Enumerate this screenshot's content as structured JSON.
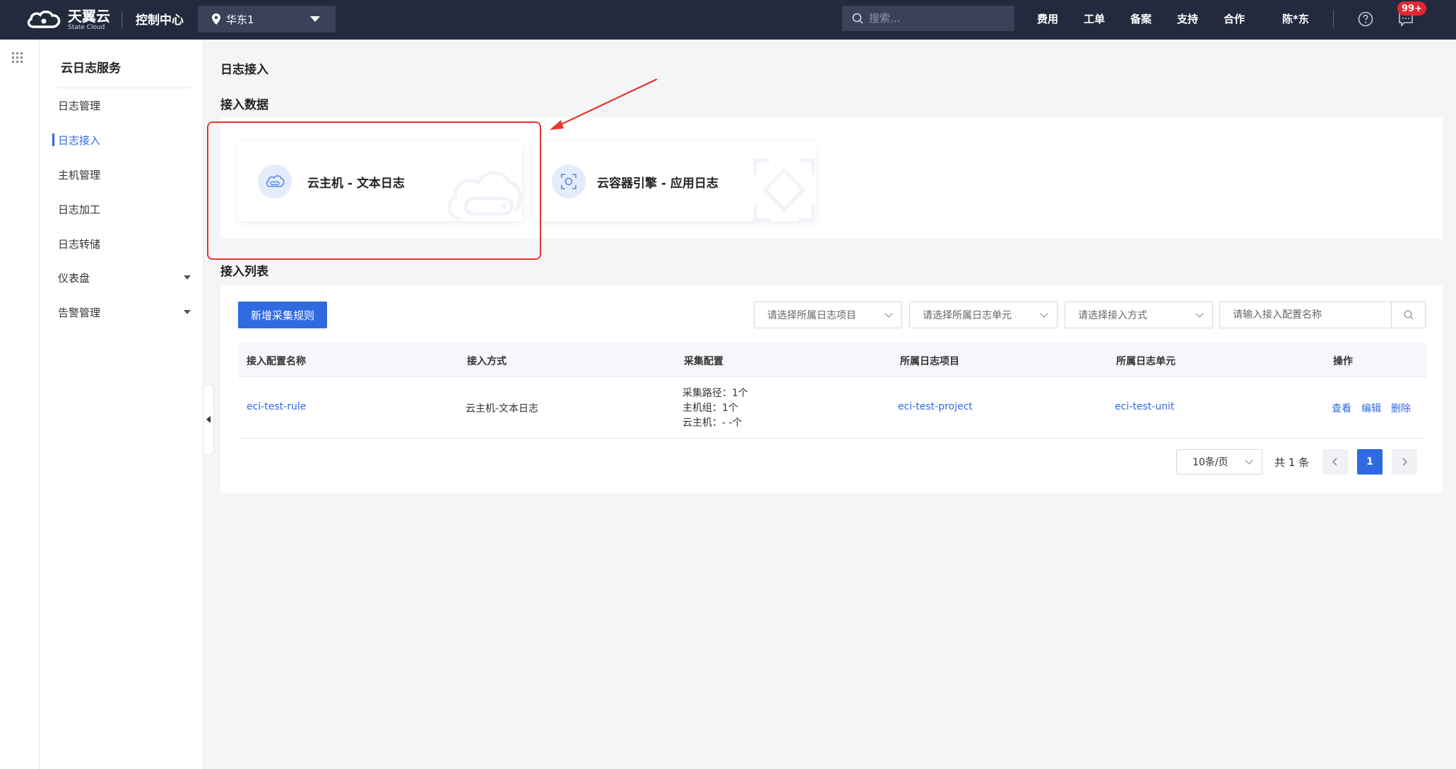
{
  "topbar": {
    "logo_main": "天翼云",
    "logo_sub": "State Cloud",
    "console_title": "控制中心",
    "region": "华东1",
    "search_placeholder": "搜索...",
    "nav": [
      "费用",
      "工单",
      "备案",
      "支持",
      "合作"
    ],
    "user": "陈*东",
    "badge": "99+"
  },
  "sidebar": {
    "title": "云日志服务",
    "items": [
      {
        "label": "日志管理"
      },
      {
        "label": "日志接入",
        "active": true
      },
      {
        "label": "主机管理"
      },
      {
        "label": "日志加工"
      },
      {
        "label": "日志转储"
      },
      {
        "label": "仪表盘",
        "expandable": true
      },
      {
        "label": "告警管理",
        "expandable": true
      }
    ]
  },
  "main": {
    "page_title": "日志接入",
    "ingest_section_title": "接入数据",
    "cards": [
      {
        "label": "云主机 - 文本日志",
        "icon": "cloud-host-icon"
      },
      {
        "label": "云容器引擎 - 应用日志",
        "icon": "container-icon"
      }
    ],
    "list_section_title": "接入列表",
    "add_button": "新增采集规则",
    "filters": {
      "project_placeholder": "请选择所属日志项目",
      "unit_placeholder": "请选择所属日志单元",
      "method_placeholder": "请选择接入方式",
      "name_placeholder": "请输入接入配置名称"
    },
    "table": {
      "headers": [
        "接入配置名称",
        "接入方式",
        "采集配置",
        "所属日志项目",
        "所属日志单元",
        "操作"
      ],
      "rows": [
        {
          "name": "eci-test-rule",
          "method": "云主机-文本日志",
          "config": [
            "采集路径：1个",
            "主机组：1个",
            "云主机：- -个"
          ],
          "project": "eci-test-project",
          "unit": "eci-test-unit",
          "actions": [
            "查看",
            "编辑",
            "删除"
          ]
        }
      ]
    },
    "pagination": {
      "page_size": "10条/页",
      "total": "共 1 条",
      "current_page": "1"
    }
  },
  "colors": {
    "topbar": "#232a3d",
    "accent": "#2f6ae1",
    "highlight": "#e8372d"
  }
}
